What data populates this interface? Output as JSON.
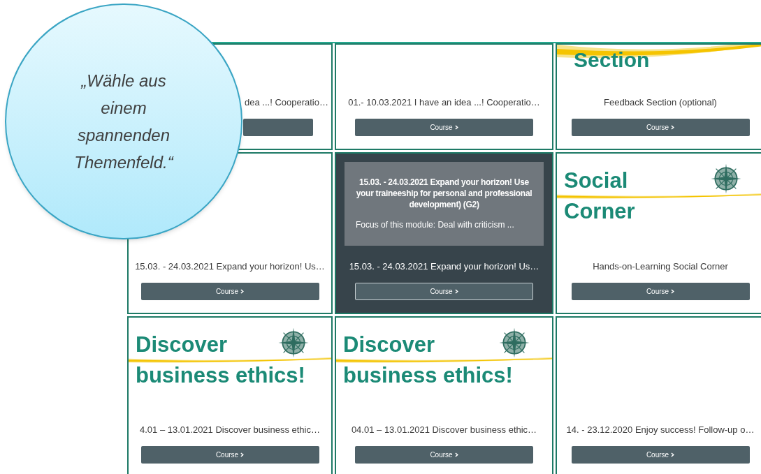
{
  "callout": {
    "text": "„Wähle aus einem spannenden Themenfeld.“"
  },
  "cards": [
    {
      "kind": "blank",
      "hovered": false,
      "title": "dea ...! Cooperatio…"
    },
    {
      "kind": "blank",
      "hovered": false,
      "title": "01.- 10.03.2021 I have an idea ...! Cooperatio…",
      "button": "Course"
    },
    {
      "kind": "banner",
      "hovered": false,
      "banner": [
        "Section"
      ],
      "compass": false,
      "title": "Feedback Section (optional)",
      "button": "Course"
    },
    {
      "kind": "blank",
      "hovered": false,
      "title": "15.03. - 24.03.2021 Expand your horizon! Us…",
      "button": "Course"
    },
    {
      "kind": "blank",
      "hovered": true,
      "overlay_title": "15.03. - 24.03.2021 Expand your horizon! Use your traineeship for personal and professional development) (G2)",
      "overlay_summary": "Focus of this module: Deal with criticism ...",
      "title": "15.03. - 24.03.2021 Expand your horizon! Us…",
      "button": "Course"
    },
    {
      "kind": "banner",
      "hovered": false,
      "banner": [
        "Social",
        "Corner"
      ],
      "compass": true,
      "title": "Hands-on-Learning Social Corner",
      "button": "Course"
    },
    {
      "kind": "banner",
      "hovered": false,
      "banner": [
        "Discover",
        "business ethics!"
      ],
      "compass": true,
      "title": "4.01 – 13.01.2021 Discover business ethic…",
      "button": "Course"
    },
    {
      "kind": "banner",
      "hovered": false,
      "banner": [
        "Discover",
        "business ethics!"
      ],
      "compass": true,
      "title": "04.01 – 13.01.2021 Discover business ethic…",
      "button": "Course"
    },
    {
      "kind": "blank",
      "hovered": false,
      "title": "14. - 23.12.2020 Enjoy success! Follow-up o…",
      "button": "Course"
    }
  ]
}
